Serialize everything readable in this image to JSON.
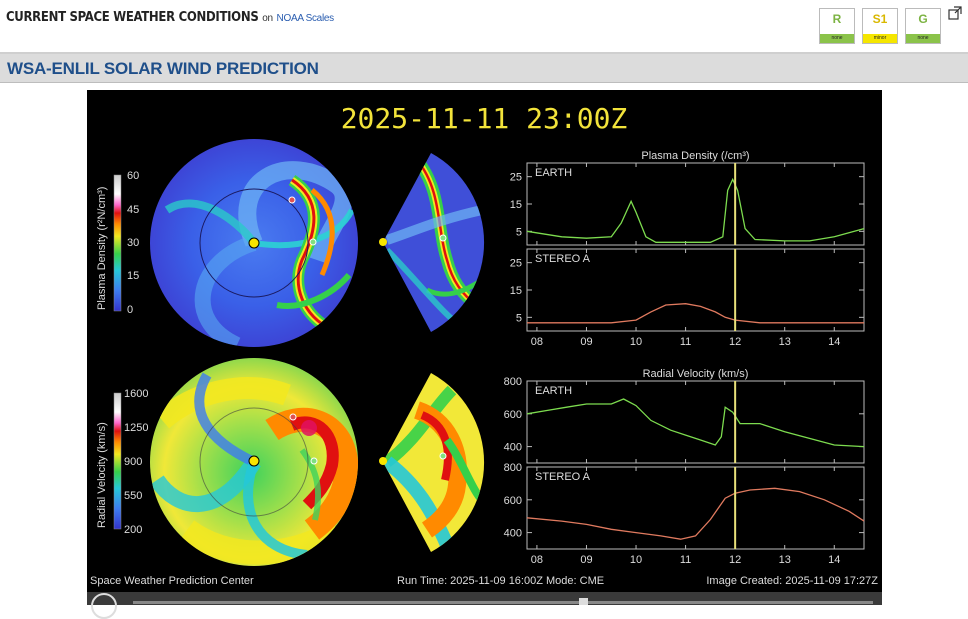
{
  "header": {
    "brand": "CURRENT SPACE WEATHER CONDITIONS",
    "on_text": "on",
    "scales_link": "NOAA Scales",
    "scales": [
      {
        "letter": "R",
        "level": "none",
        "color": "#8bc34a"
      },
      {
        "letter": "S1",
        "level": "minor",
        "color": "#f5e600"
      },
      {
        "letter": "G",
        "level": "none",
        "color": "#8bc34a"
      }
    ],
    "popout_icon": "external-window-icon"
  },
  "section": {
    "title": "WSA-ENLIL SOLAR WIND PREDICTION"
  },
  "figure": {
    "timestamp": "2025-11-11  23:00Z",
    "footer_left": "Space Weather Prediction Center",
    "footer_mid": "Run Time: 2025-11-09 16:00Z  Mode: CME",
    "footer_right": "Image Created: 2025-11-09 17:27Z",
    "density_colorbar": {
      "label": "Plasma Density (r²N/cm³)",
      "ticks": [
        "60",
        "45",
        "30",
        "15",
        "0"
      ]
    },
    "velocity_colorbar": {
      "label": "Radial Velocity (km/s)",
      "ticks": [
        "1600",
        "1250",
        "900",
        "550",
        "200"
      ]
    }
  },
  "chart_data": [
    {
      "type": "line",
      "title": "Plasma Density (/cm³)",
      "panel": "EARTH",
      "ylim": [
        0,
        30
      ],
      "yticks": [
        5,
        15,
        25
      ],
      "xlim": [
        7.8,
        14.6
      ],
      "xticks": [
        "08",
        "09",
        "10",
        "11",
        "12",
        "13",
        "14"
      ],
      "current_time_marker": 12,
      "series": [
        {
          "color": "#7ddc4f",
          "x": [
            7.8,
            8.5,
            9.0,
            9.5,
            9.7,
            9.9,
            10.0,
            10.2,
            10.4,
            11.0,
            11.5,
            11.75,
            11.85,
            11.95,
            12.05,
            12.2,
            12.4,
            13.0,
            13.5,
            14.0,
            14.6
          ],
          "y": [
            5,
            3,
            2.5,
            3,
            8,
            16,
            12,
            3,
            1,
            1,
            1,
            3,
            20,
            24,
            20,
            6,
            2,
            1.5,
            1.5,
            3,
            6
          ]
        }
      ]
    },
    {
      "type": "line",
      "panel": "STEREO A",
      "ylim": [
        0,
        30
      ],
      "yticks": [
        5,
        15,
        25
      ],
      "xlim": [
        7.8,
        14.6
      ],
      "xticks": [
        "08",
        "09",
        "10",
        "11",
        "12",
        "13",
        "14"
      ],
      "current_time_marker": 12,
      "series": [
        {
          "color": "#e07a5f",
          "x": [
            7.8,
            8.5,
            9.0,
            9.5,
            10.0,
            10.3,
            10.6,
            11.0,
            11.3,
            11.6,
            11.8,
            12.0,
            12.5,
            13.0,
            14.0,
            14.6
          ],
          "y": [
            3,
            3,
            3,
            3,
            4,
            7,
            9.5,
            10,
            9,
            7,
            5,
            4,
            3,
            3,
            3,
            3
          ]
        }
      ]
    },
    {
      "type": "line",
      "title": "Radial Velocity (km/s)",
      "panel": "EARTH",
      "ylim": [
        300,
        800
      ],
      "yticks": [
        400,
        600,
        800
      ],
      "xlim": [
        7.8,
        14.6
      ],
      "xticks": [
        "08",
        "09",
        "10",
        "11",
        "12",
        "13",
        "14"
      ],
      "current_time_marker": 12,
      "series": [
        {
          "color": "#7ddc4f",
          "x": [
            7.8,
            8.2,
            8.6,
            9.0,
            9.5,
            9.75,
            10.0,
            10.3,
            10.7,
            11.0,
            11.3,
            11.6,
            11.72,
            11.8,
            11.95,
            12.1,
            12.5,
            13.0,
            13.5,
            14.0,
            14.6
          ],
          "y": [
            600,
            620,
            640,
            660,
            660,
            690,
            650,
            560,
            500,
            470,
            440,
            410,
            460,
            640,
            610,
            540,
            540,
            490,
            450,
            410,
            400
          ]
        }
      ]
    },
    {
      "type": "line",
      "panel": "STEREO A",
      "ylim": [
        300,
        800
      ],
      "yticks": [
        400,
        600,
        800
      ],
      "xlim": [
        7.8,
        14.6
      ],
      "xticks": [
        "08",
        "09",
        "10",
        "11",
        "12",
        "13",
        "14"
      ],
      "current_time_marker": 12,
      "series": [
        {
          "color": "#e07a5f",
          "x": [
            7.8,
            8.5,
            9.0,
            9.5,
            10.0,
            10.5,
            10.9,
            11.2,
            11.5,
            11.8,
            12.0,
            12.3,
            12.8,
            13.3,
            13.8,
            14.3,
            14.6
          ],
          "y": [
            490,
            470,
            450,
            420,
            400,
            380,
            360,
            380,
            480,
            610,
            640,
            660,
            670,
            650,
            600,
            530,
            470
          ]
        }
      ]
    }
  ]
}
